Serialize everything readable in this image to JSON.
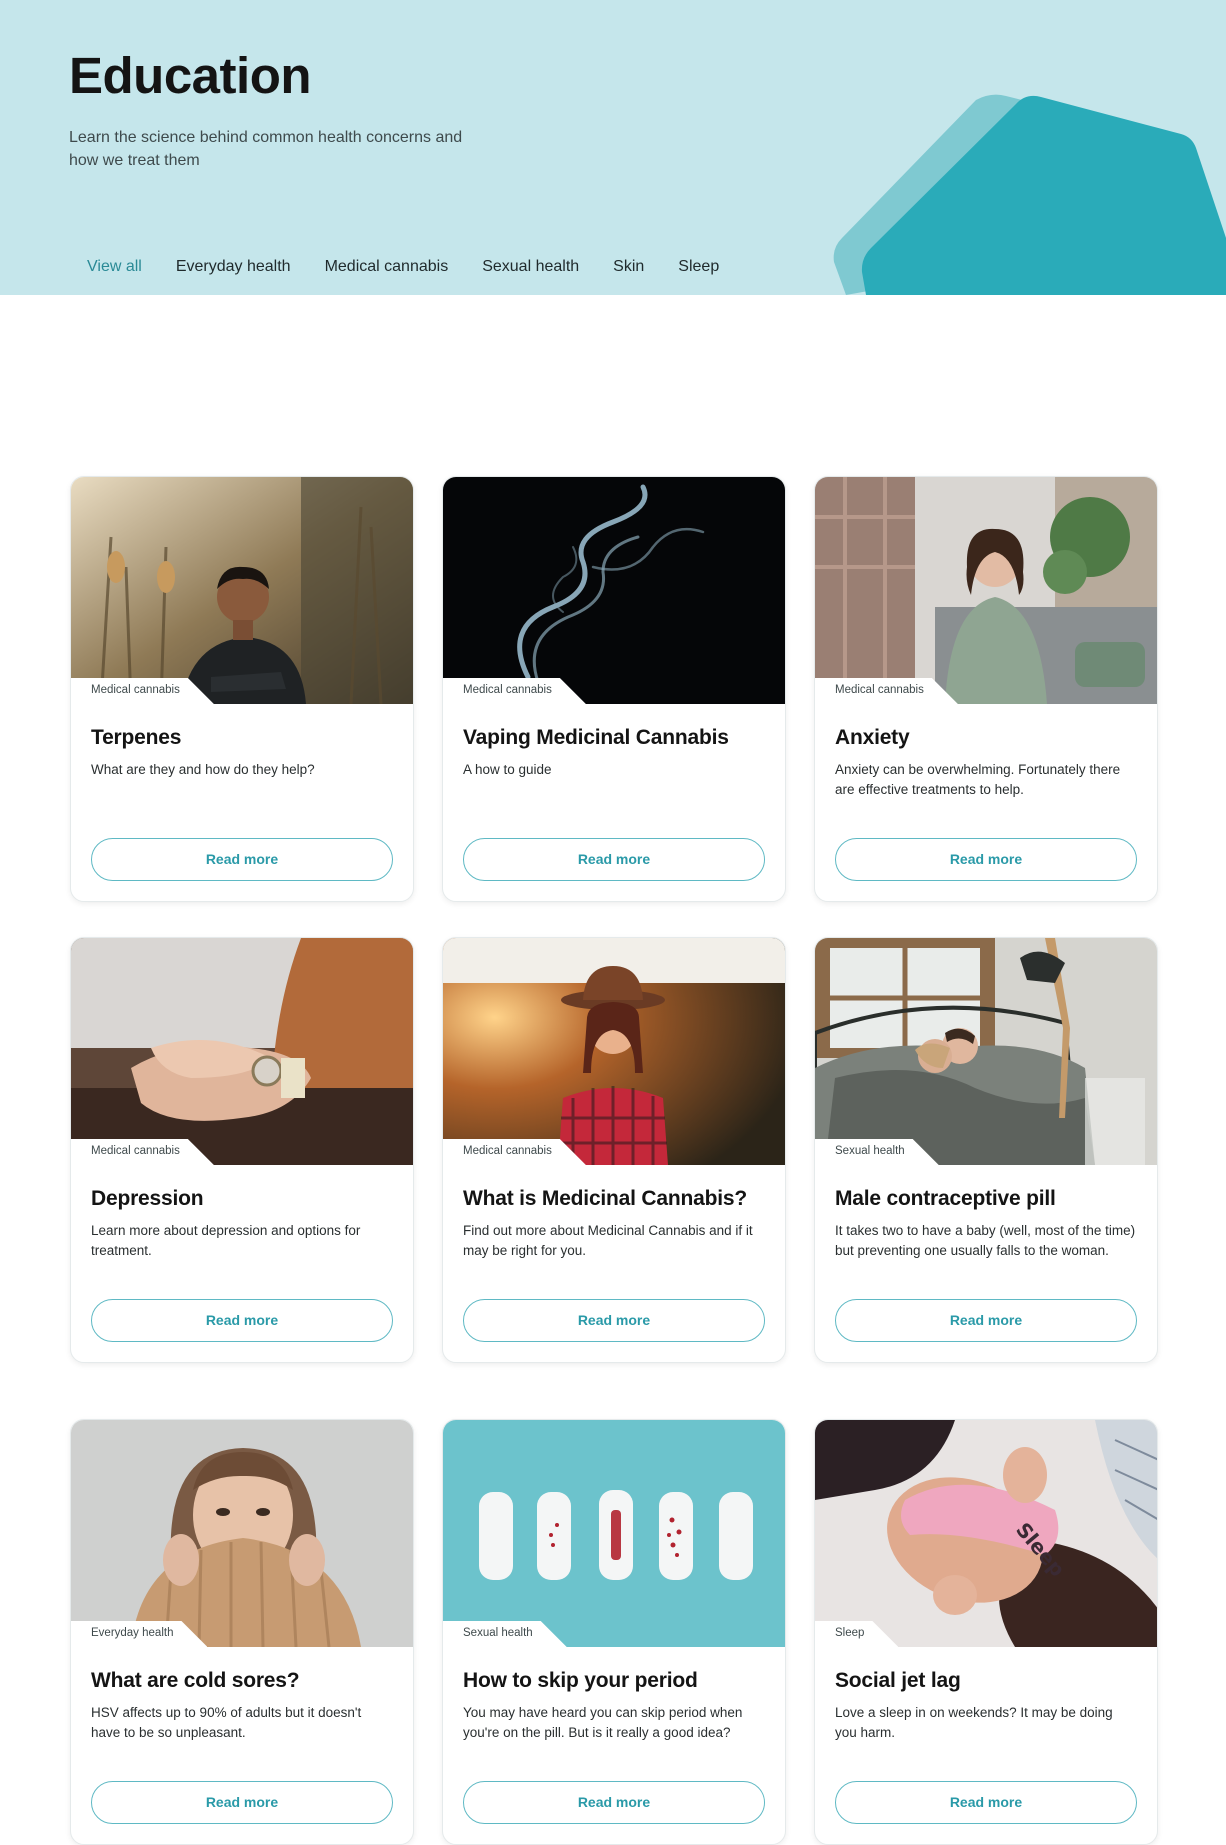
{
  "hero": {
    "title": "Education",
    "subtitle": "Learn the science behind common health concerns and how we treat them",
    "colors": {
      "background": "#c5e6eb",
      "accent": "#2aabb9",
      "accent_light": "#7fc9d1"
    }
  },
  "tabs": [
    {
      "label": "View all",
      "active": true
    },
    {
      "label": "Everyday health",
      "active": false
    },
    {
      "label": "Medical cannabis",
      "active": false
    },
    {
      "label": "Sexual health",
      "active": false
    },
    {
      "label": "Skin",
      "active": false
    },
    {
      "label": "Sleep",
      "active": false
    }
  ],
  "cards": [
    {
      "tag": "Medical cannabis",
      "title": "Terpenes",
      "description": "What are they and how do they help?",
      "button": "Read more",
      "image": "man-smiling-in-field-photo"
    },
    {
      "tag": "Medical cannabis",
      "title": "Vaping Medicinal Cannabis",
      "description": "A how to guide",
      "button": "Read more",
      "image": "smoke-on-black-photo"
    },
    {
      "tag": "Medical cannabis",
      "title": "Anxiety",
      "description": "Anxiety can be overwhelming. Fortunately there are effective treatments to help.",
      "button": "Read more",
      "image": "woman-on-sofa-photo"
    },
    {
      "tag": "Medical cannabis",
      "title": "Depression",
      "description": "Learn more about depression and options for treatment.",
      "button": "Read more",
      "image": "holding-hands-photo"
    },
    {
      "tag": "Medical cannabis",
      "title": "What is Medicinal Cannabis?",
      "description": "Find out more about Medicinal Cannabis and if it may be right for you.",
      "button": "Read more",
      "image": "woman-in-hat-sunset-photo"
    },
    {
      "tag": "Sexual health",
      "title": "Male contraceptive pill",
      "description": "It takes two to have a baby (well, most of the time) but preventing one usually falls to the woman.",
      "button": "Read more",
      "image": "couple-in-bed-photo"
    },
    {
      "tag": "Everyday health",
      "title": "What are cold sores?",
      "description": "HSV affects up to 90% of adults but it doesn't have to be so unpleasant.",
      "button": "Read more",
      "image": "woman-covering-mouth-photo"
    },
    {
      "tag": "Sexual health",
      "title": "How to skip your period",
      "description": "You may have heard you can skip period when you're on the pill. But is it really a good idea?",
      "button": "Read more",
      "image": "sanitary-pads-photo"
    },
    {
      "tag": "Sleep",
      "title": "Social jet lag",
      "description": "Love a sleep in on weekends? It may be doing you harm.",
      "button": "Read more",
      "image": "woman-with-sleep-mask-photo"
    }
  ]
}
